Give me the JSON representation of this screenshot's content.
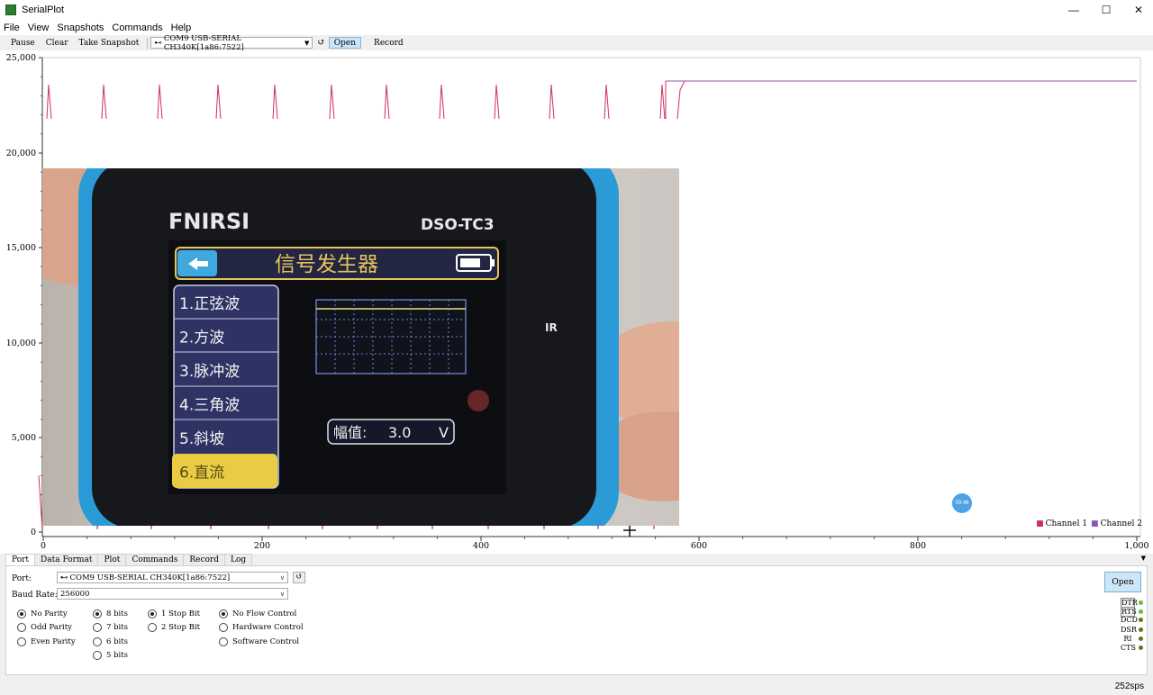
{
  "window": {
    "title": "SerialPlot",
    "minimize": "—",
    "maximize": "☐",
    "close": "✕"
  },
  "menu": [
    "File",
    "View",
    "Snapshots",
    "Commands",
    "Help"
  ],
  "toolbar": {
    "pause": "Pause",
    "clear": "Clear",
    "take_snapshot": "Take Snapshot",
    "port": "COM9 USB-SERIAL CH340K[1a86:7522]",
    "open": "Open",
    "record": "Record"
  },
  "plot": {
    "y_ticks": [
      "25,000",
      "20,000",
      "15,000",
      "10,000",
      "5,000",
      "0"
    ],
    "x_ticks": [
      "0",
      "200",
      "400",
      "600",
      "800",
      "1,000"
    ],
    "legend": [
      {
        "name": "Channel 1",
        "color": "#d0305f"
      },
      {
        "name": "Channel 2",
        "color": "#8e55b5"
      }
    ],
    "timer_badge": "00:46"
  },
  "photo": {
    "brand": "FNIRSI",
    "model": "DSO-TC3",
    "ir": "IR",
    "screen_title": "信号发生器",
    "menu_items": [
      "1.正弦波",
      "2.方波",
      "3.脉冲波",
      "4.三角波",
      "5.斜坡",
      "6.直流"
    ],
    "selected_index": 5,
    "amp_label": "幅值:",
    "amp_value": "3.0",
    "amp_unit": "V"
  },
  "tabs": [
    "Port",
    "Data Format",
    "Plot",
    "Commands",
    "Record",
    "Log"
  ],
  "port_settings": {
    "port_label": "Port:",
    "port_value": "COM9 USB-SERIAL CH340K[1a86:7522]",
    "baud_label": "Baud Rate:",
    "baud_value": "256000",
    "parity": [
      "No Parity",
      "Odd Parity",
      "Even Parity"
    ],
    "data_bits": [
      "8 bits",
      "7 bits",
      "6 bits",
      "5 bits"
    ],
    "stop_bits": [
      "1 Stop Bit",
      "2 Stop Bit"
    ],
    "flow": [
      "No Flow Control",
      "Hardware Control",
      "Software Control"
    ],
    "open_button": "Open",
    "pins": [
      {
        "name": "DTR",
        "color": "#5cc23a",
        "boxed": true
      },
      {
        "name": "RTS",
        "color": "#5cc23a",
        "boxed": true
      },
      {
        "name": "DCD",
        "color": "#5b7a1e",
        "boxed": false
      },
      {
        "name": "DSR",
        "color": "#5b7a1e",
        "boxed": false
      },
      {
        "name": "RI",
        "color": "#5b7a1e",
        "boxed": false
      },
      {
        "name": "CTS",
        "color": "#5b7a1e",
        "boxed": false
      }
    ]
  },
  "status": {
    "rate": "252sps"
  },
  "chart_data": {
    "type": "line",
    "x_range": [
      0,
      1000
    ],
    "y_range": [
      0,
      25000
    ],
    "xlabel": "",
    "ylabel": "",
    "series": [
      {
        "name": "Channel 1",
        "description_points": [
          [
            0,
            0
          ],
          [
            5,
            23800
          ],
          [
            10,
            0
          ],
          [
            55,
            0
          ],
          [
            60,
            23800
          ],
          [
            65,
            0
          ],
          [
            570,
            23700
          ],
          [
            1000,
            23700
          ]
        ]
      },
      {
        "name": "Channel 2",
        "description_points": [
          [
            570,
            23800
          ],
          [
            1000,
            23800
          ]
        ]
      }
    ]
  }
}
